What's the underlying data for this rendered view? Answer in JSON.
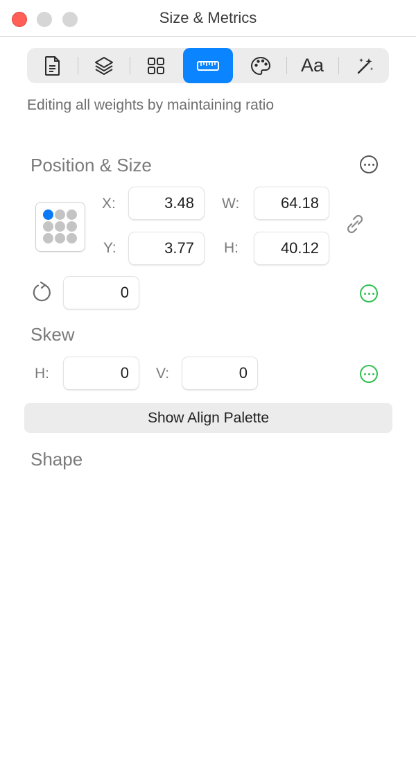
{
  "window": {
    "title": "Size & Metrics"
  },
  "toolbar": {
    "tabs": [
      {
        "name": "document",
        "icon": "document-icon"
      },
      {
        "name": "layers",
        "icon": "layers-icon"
      },
      {
        "name": "components",
        "icon": "grid-icon"
      },
      {
        "name": "size-metrics",
        "icon": "ruler-icon",
        "active": true
      },
      {
        "name": "style",
        "icon": "palette-icon"
      },
      {
        "name": "typography",
        "icon": "text-icon",
        "label": "Aa"
      },
      {
        "name": "effects",
        "icon": "magic-wand-icon"
      }
    ],
    "accent_color": "#0a84ff"
  },
  "hint_text": "Editing all weights by maintaining ratio",
  "position_size": {
    "title": "Position & Size",
    "x_label": "X:",
    "x_value": "3.48",
    "y_label": "Y:",
    "y_value": "3.77",
    "w_label": "W:",
    "w_value": "64.18",
    "h_label": "H:",
    "h_value": "40.12",
    "rotation_value": "0",
    "anchor_selected": "top-left"
  },
  "skew": {
    "title": "Skew",
    "h_label": "H:",
    "h_value": "0",
    "v_label": "V:",
    "v_value": "0"
  },
  "align_button_label": "Show Align Palette",
  "shape": {
    "title": "Shape"
  }
}
